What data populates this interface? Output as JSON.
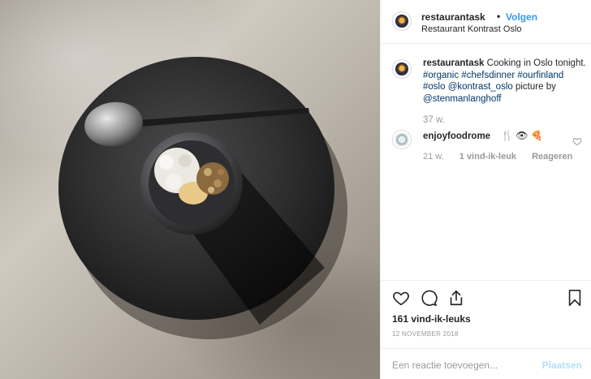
{
  "post": {
    "username": "restaurantask",
    "separator": "•",
    "follow_label": "Volgen",
    "location": "Restaurant Kontrast Oslo",
    "avatar_icon": "restaurant-avatar"
  },
  "caption": {
    "username": "restaurantask",
    "text": " Cooking in Oslo tonight.",
    "tags": [
      "#organic",
      "#chefsdinner",
      "#ourfinland",
      "#oslo",
      "@kontrast_oslo"
    ],
    "suffix_text": " picture by",
    "credit": "@stenmanlanghoff",
    "time": "37 w."
  },
  "comment": {
    "username": "enjoyfoodrome",
    "emojis": "🍴 👁 🍕",
    "time": "21 w.",
    "likes": "1 vind-ik-leuk",
    "reply": "Reageren",
    "avatar_icon": "enjoyfoodrome-avatar"
  },
  "actions": {
    "like_icon": "heart-icon",
    "comment_icon": "comment-icon",
    "share_icon": "share-icon",
    "save_icon": "bookmark-icon"
  },
  "stats": {
    "likes": "161 vind-ik-leuks",
    "date": "12 NOVEMBER 2018"
  },
  "add_comment": {
    "placeholder": "Een reactie toevoegen...",
    "post_label": "Plaatsen"
  },
  "colors": {
    "link": "#3897f0",
    "hashtag": "#003569",
    "muted": "#999999",
    "post_disabled": "#b2dffc"
  }
}
